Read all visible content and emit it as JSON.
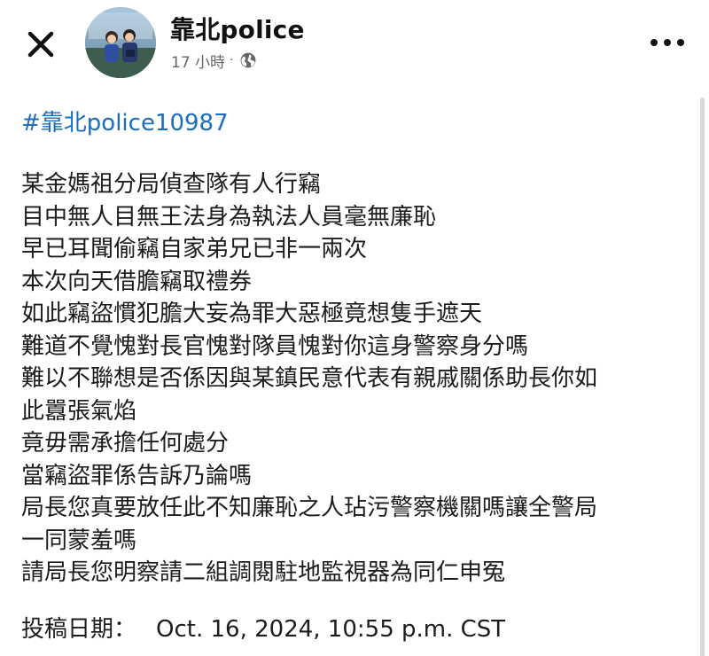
{
  "header": {
    "author_name": "靠北police",
    "post_time": "17 小時",
    "separator": "·",
    "audience_icon": "globe-icon",
    "close_icon": "close-icon",
    "more_icon": "more-options-icon"
  },
  "post": {
    "hashtag": "#靠北police10987",
    "body_lines": [
      "某金媽祖分局偵查隊有人行竊",
      "目中無人目無王法身為執法人員毫無廉恥",
      "早已耳聞偷竊自家弟兄已非一兩次",
      "本次向天借膽竊取禮券",
      "如此竊盜慣犯膽大妄為罪大惡極竟想隻手遮天",
      "難道不覺愧對長官愧對隊員愧對你這身警察身分嗎",
      "難以不聯想是否係因與某鎮民意代表有親戚關係助長你如",
      "此囂張氣焰",
      "竟毋需承擔任何處分",
      "當竊盜罪係告訴乃論嗎",
      "局長您真要放任此不知廉恥之人玷污警察機關嗎讓全警局",
      "一同蒙羞嗎",
      "請局長您明察請二組調閱駐地監視器為同仁申冤"
    ],
    "submission_label": "投稿日期：",
    "submission_date": "Oct. 16, 2024, 10:55 p.m. CST"
  },
  "colors": {
    "hashtag": "#1a6dbf",
    "meta_text": "#65676b",
    "body_text": "#1c1c1c"
  }
}
